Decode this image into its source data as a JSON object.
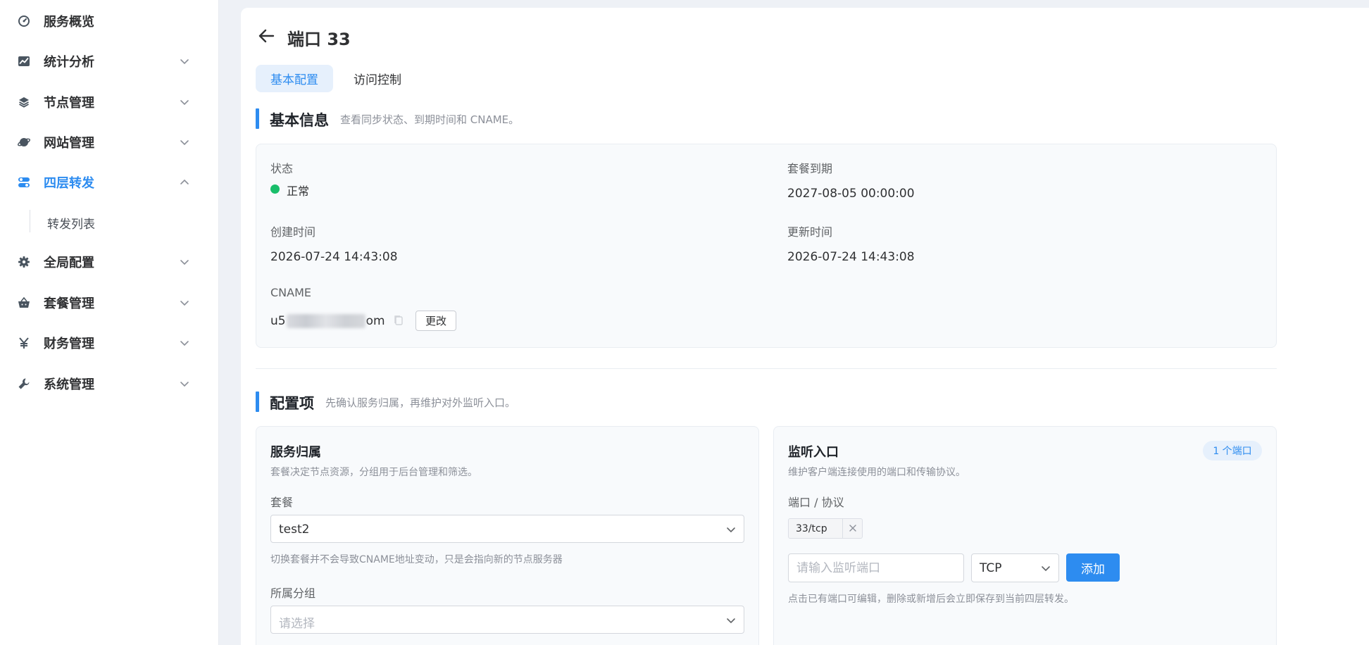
{
  "sidebar": {
    "items": [
      {
        "label": "服务概览",
        "icon": "dashboard-icon",
        "expanded": null
      },
      {
        "label": "统计分析",
        "icon": "chart-icon",
        "expanded": false
      },
      {
        "label": "节点管理",
        "icon": "layers-icon",
        "expanded": false
      },
      {
        "label": "网站管理",
        "icon": "globe-icon",
        "expanded": false
      },
      {
        "label": "四层转发",
        "icon": "toggle-icon",
        "expanded": true,
        "active": true
      },
      {
        "label": "全局配置",
        "icon": "gear-icon",
        "expanded": false
      },
      {
        "label": "套餐管理",
        "icon": "basket-icon",
        "expanded": false
      },
      {
        "label": "财务管理",
        "icon": "yen-icon",
        "expanded": false
      },
      {
        "label": "系统管理",
        "icon": "wrench-icon",
        "expanded": false
      }
    ],
    "submenu": {
      "label": "转发列表"
    }
  },
  "header": {
    "title": "端口 33"
  },
  "tabs": [
    {
      "label": "基本配置",
      "active": true
    },
    {
      "label": "访问控制",
      "active": false
    }
  ],
  "basic_info": {
    "title": "基本信息",
    "desc": "查看同步状态、到期时间和 CNAME。",
    "status_label": "状态",
    "status_value": "正常",
    "status_color": "#19be6b",
    "expire_label": "套餐到期",
    "expire_value": "2027-08-05 00:00:00",
    "created_label": "创建时间",
    "created_value": "2026-07-24 14:43:08",
    "updated_label": "更新时间",
    "updated_value": "2026-07-24 14:43:08",
    "cname_label": "CNAME",
    "cname_prefix": "u5",
    "cname_suffix": "om",
    "change_button": "更改"
  },
  "config": {
    "title": "配置项",
    "desc": "先确认服务归属，再维护对外监听入口。",
    "ownership": {
      "title": "服务归属",
      "desc": "套餐决定节点资源，分组用于后台管理和筛选。",
      "plan_label": "套餐",
      "plan_value": "test2",
      "plan_hint": "切换套餐并不会导致CNAME地址变动，只是会指向新的节点服务器",
      "group_label": "所属分组",
      "group_placeholder": "请选择"
    },
    "listener": {
      "title": "监听入口",
      "badge": "1 个端口",
      "desc": "维护客户端连接使用的端口和传输协议。",
      "ports_label": "端口 / 协议",
      "ports": [
        "33/tcp"
      ],
      "port_placeholder": "请输入监听端口",
      "protocol_value": "TCP",
      "add_button": "添加",
      "hint": "点击已有端口可编辑，删除或新增后会立即保存到当前四层转发。"
    }
  },
  "colors": {
    "accent": "#2d8cf0",
    "success": "#19be6b"
  }
}
